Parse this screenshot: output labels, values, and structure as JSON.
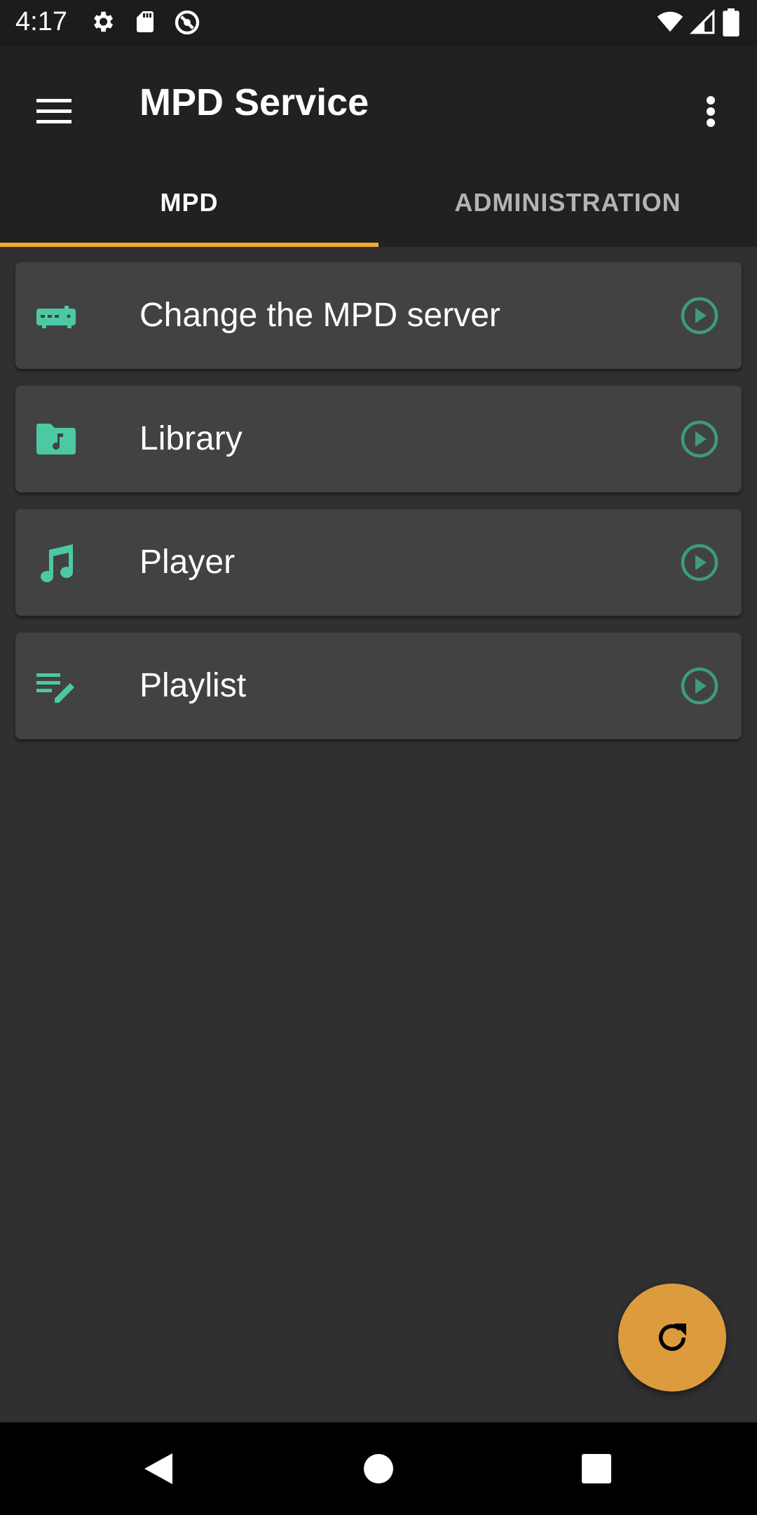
{
  "status_bar": {
    "time": "4:17",
    "icons": [
      "gear-icon",
      "sd-card-icon",
      "sync-icon",
      "wifi-icon",
      "signal-icon",
      "battery-icon"
    ]
  },
  "app_bar": {
    "title": "MPD Service",
    "menu_icon": "hamburger-menu-icon",
    "overflow_icon": "more-vert-icon"
  },
  "tabs": [
    {
      "label": "MPD",
      "selected": true
    },
    {
      "label": "ADMINISTRATION",
      "selected": false
    }
  ],
  "items": [
    {
      "label": "Change the MPD server",
      "icon": "router-icon"
    },
    {
      "label": "Library",
      "icon": "music-folder-icon"
    },
    {
      "label": "Player",
      "icon": "music-note-icon"
    },
    {
      "label": "Playlist",
      "icon": "playlist-edit-icon"
    }
  ],
  "fab": {
    "icon": "refresh-icon"
  },
  "nav_bar": {
    "icons": [
      "back-icon",
      "home-icon",
      "recents-icon"
    ]
  },
  "colors": {
    "accent": "#f4ac2f",
    "fab": "#dc9c3e",
    "icon_teal": "#4cc9a4",
    "play_teal": "#3d9b80",
    "background": "#303030",
    "card": "#424242",
    "app_bar": "#212121"
  }
}
